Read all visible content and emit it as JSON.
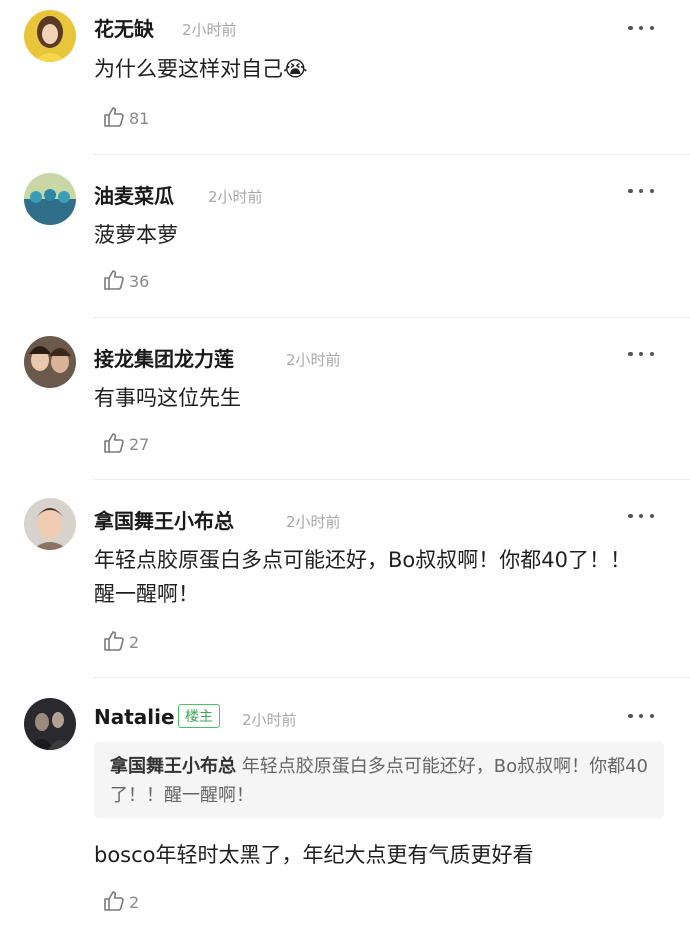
{
  "comments": [
    {
      "username": "花无缺",
      "time": "2小时前",
      "text": "为什么要这样对自己😭",
      "likes": "81",
      "avatar_icon": "avatar-woman-yellow"
    },
    {
      "username": "油麦菜瓜",
      "time": "2小时前",
      "text": "菠萝本萝",
      "likes": "36",
      "avatar_icon": "avatar-teal-figures"
    },
    {
      "username": "接龙集团龙力莲",
      "time": "2小时前",
      "text": "有事吗这位先生",
      "likes": "27",
      "avatar_icon": "avatar-two-people"
    },
    {
      "username": "拿国舞王小布总",
      "time": "2小时前",
      "text": "年轻点胶原蛋白多点可能还好，Bo叔叔啊！你都40了！！醒一醒啊！",
      "likes": "2",
      "avatar_icon": "avatar-portrait"
    },
    {
      "username": "Natalie",
      "badge": "楼主",
      "time": "2小时前",
      "quote_name": "拿国舞王小布总",
      "quote_text": "年轻点胶原蛋白多点可能还好，Bo叔叔啊！你都40了！！醒一醒啊！",
      "text": "bosco年轻时太黑了，年纪大点更有气质更好看",
      "likes": "2",
      "avatar_icon": "avatar-dark-crowd"
    }
  ],
  "colors": {
    "badge_green": "#3aa957",
    "time_gray": "#a8a8a8",
    "like_gray": "#8a8a8a"
  },
  "icons": {
    "like": "thumbs-up-icon",
    "more": "more-dots-icon"
  }
}
